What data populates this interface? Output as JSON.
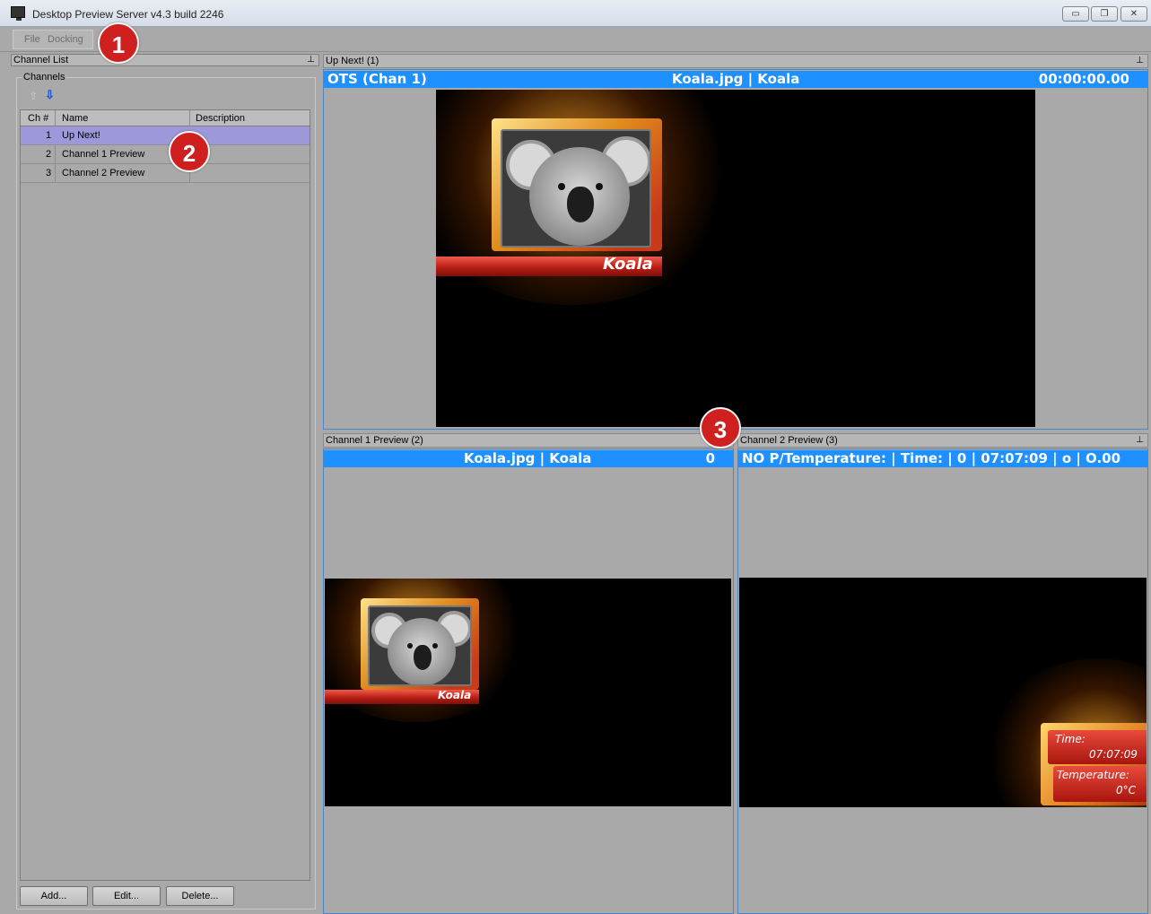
{
  "window": {
    "title": "Desktop Preview Server v4.3 build 2246",
    "minimize_glyph": "▭",
    "restore_glyph": "❐",
    "close_glyph": "✕"
  },
  "menu": {
    "file": "File",
    "docking": "Docking"
  },
  "callouts": [
    "1",
    "2",
    "3"
  ],
  "channel_list": {
    "panel_title": "Channel List",
    "pin_glyph": "⊥",
    "group_label": "Channels",
    "move_up_icon": "arrow-up-icon",
    "move_down_icon": "arrow-down-icon",
    "columns": [
      "Ch #",
      "Name",
      "Description"
    ],
    "rows": [
      {
        "ch": "1",
        "name": "Up Next!",
        "description": "",
        "selected": true
      },
      {
        "ch": "2",
        "name": "Channel 1 Preview",
        "description": ""
      },
      {
        "ch": "3",
        "name": "Channel 2 Preview",
        "description": ""
      }
    ],
    "buttons": {
      "add": "Add...",
      "edit": "Edit...",
      "delete": "Delete..."
    }
  },
  "panes": {
    "up_next": {
      "title": "Up Next! (1)",
      "left": "OTS  (Chan 1)",
      "center": "Koala.jpg | Koala",
      "right": "00:00:00.00",
      "graphic_label": "Koala"
    },
    "ch1": {
      "title": "Channel 1 Preview (2)",
      "center": "Koala.jpg | Koala",
      "right": "0",
      "graphic_label": "Koala"
    },
    "ch2": {
      "title": "Channel 2 Preview (3)",
      "bar": "NO P/Temperature: | Time: | 0 | 07:07:09 | o | O.00",
      "widget_time_label": "Time:",
      "widget_time_value": "07:07:09",
      "widget_temp_label": "Temperature:",
      "widget_temp_value": "0°C"
    }
  },
  "colors": {
    "accent_bar": "#1E90FF",
    "selected_row": "#9C98D9",
    "badge": "#CF1F1F"
  }
}
